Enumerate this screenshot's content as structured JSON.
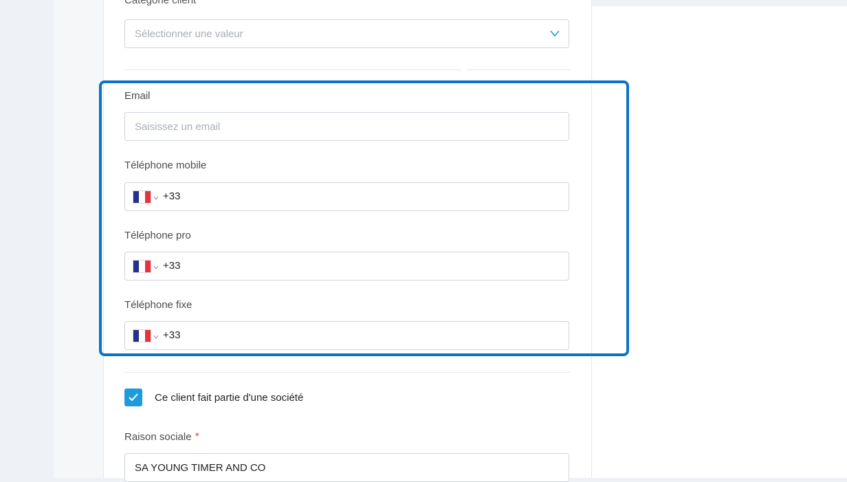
{
  "form": {
    "categorie": {
      "label": "Catégorie client",
      "placeholder": "Sélectionner une valeur"
    },
    "email": {
      "label": "Email",
      "placeholder": "Saisissez un email"
    },
    "tel_mobile": {
      "label": "Téléphone mobile",
      "dial_code": "+33",
      "country": "France"
    },
    "tel_pro": {
      "label": "Téléphone pro",
      "dial_code": "+33",
      "country": "France"
    },
    "tel_fixe": {
      "label": "Téléphone fixe",
      "dial_code": "+33",
      "country": "France"
    },
    "societe_checkbox": {
      "label": "Ce client fait partie d'une société",
      "checked": true
    },
    "raison_sociale": {
      "label": "Raison sociale",
      "required_mark": "*",
      "value": "SA YOUNG TIMER AND CO"
    }
  },
  "colors": {
    "highlight": "#0c72c9",
    "checkbox": "#1d9bdd",
    "required": "#e0493f",
    "flag_blue": "#23318e",
    "flag_red": "#e8313f"
  },
  "icons": [
    "chevron-down-icon",
    "flag-fr-icon",
    "checkmark-icon"
  ]
}
